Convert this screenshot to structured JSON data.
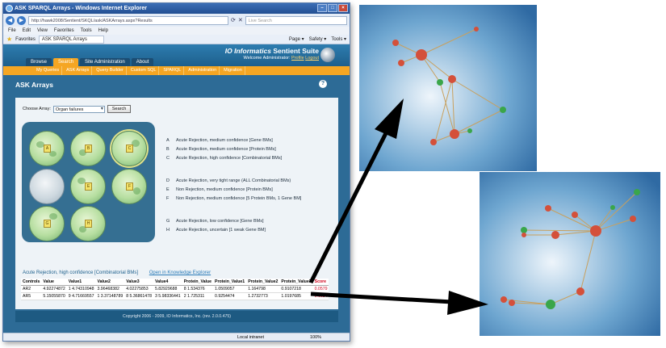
{
  "browser": {
    "window_title": "ASK SPARQL Arrays - Windows Internet Explorer",
    "url": "http://hawk2008/Sentient/SKQL/ask/ASKArrays.aspx?Results",
    "search_placeholder": "Live Search",
    "menu": [
      "File",
      "Edit",
      "View",
      "Favorites",
      "Tools",
      "Help"
    ],
    "favorites_label": "Favorites",
    "tab_label": "ASK SPARQL Arrays",
    "toolbar_right": [
      "Page ▾",
      "Safety ▾",
      "Tools ▾"
    ],
    "status_zone": "Local intranet",
    "zoom": "100%"
  },
  "app": {
    "brand_a": "IO Informatics",
    "brand_b": "Sentient Suite",
    "welcome": "Welcome Administrator:",
    "profile": "Profile",
    "logout": "Logout",
    "tabs": [
      {
        "label": "Browse",
        "active": false
      },
      {
        "label": "Search",
        "active": true
      },
      {
        "label": "Site Administration",
        "active": false
      },
      {
        "label": "About",
        "active": false
      }
    ],
    "subnav": [
      "My Queries",
      "ASK Arrays",
      "Query Builder",
      "Custom SQL",
      "SPARQL",
      "Administration",
      "Migration"
    ],
    "page_title": "ASK Arrays",
    "help_icon": "?",
    "choose_label": "Choose Array:",
    "choose_value": "Organ failures",
    "search_button": "Search",
    "wells": [
      {
        "num": "A",
        "state": "green"
      },
      {
        "num": "B",
        "state": "green"
      },
      {
        "num": "C",
        "state": "selected"
      },
      {
        "num": "",
        "state": "grey"
      },
      {
        "num": "E",
        "state": "green"
      },
      {
        "num": "F",
        "state": "green"
      },
      {
        "num": "G",
        "state": "green"
      },
      {
        "num": "H",
        "state": "green"
      }
    ],
    "legend": [
      {
        "letter": "A",
        "text": "Acute Rejection, medium confidence [Gene BMs]"
      },
      {
        "letter": "B",
        "text": "Acute Rejection, medium confidence [Protein BMs]"
      },
      {
        "letter": "C",
        "text": "Acute Rejection, high confidence [Combinatorial BMs]"
      },
      {
        "letter": "D",
        "text": "Acute Rejection, very tight range (ALL Combinatorial BMs)"
      },
      {
        "letter": "E",
        "text": "Non Rejection, medium confidence [Protein BMs]"
      },
      {
        "letter": "F",
        "text": "Non Rejection, medium confidence [5 Protein BMs, 1 Gene BM]"
      },
      {
        "letter": "G",
        "text": "Acute Rejection, low confidence [Gene BMs]"
      },
      {
        "letter": "H",
        "text": "Acute Rejection, uncertain [1 weak Gene BM]"
      }
    ],
    "result_title": "Acute Rejection, high confidence [Combinatorial BMs]",
    "open_link": "Open in Knowledge Explorer",
    "table": {
      "headers": [
        "Controls",
        "Value",
        "Value1",
        "Value2",
        "Value3",
        "Value4",
        "Protein_Value",
        "Protein_Value1",
        "Protein_Value2",
        "Protein_Value3",
        "Score"
      ],
      "rows": [
        [
          "AR2",
          "4.92274872",
          "1 4.74310948",
          "3.96468382",
          "4.02275853",
          "5.82929688",
          "8 1.534376",
          "1.0509057",
          "1.164798",
          "0.9107218",
          "0.0579"
        ],
        [
          "AR5",
          "5.15055870",
          "9 4.71669557",
          "1 3.37148789",
          "8 5.36861478",
          "3 5.98336441",
          "2 1.725311",
          "0.9254474",
          "1.2732773",
          "1.0197685",
          "0.1584"
        ]
      ]
    },
    "footer": "Copyright 2006 - 2009, IO Informatics, Inc. (rev. 2.0.0.475)"
  },
  "colors": {
    "header_blue": "#2e7db0",
    "tab_orange": "#f5a623",
    "score_red": "#d0021b",
    "node_red": "#d4503a",
    "node_green": "#3aa64a"
  }
}
